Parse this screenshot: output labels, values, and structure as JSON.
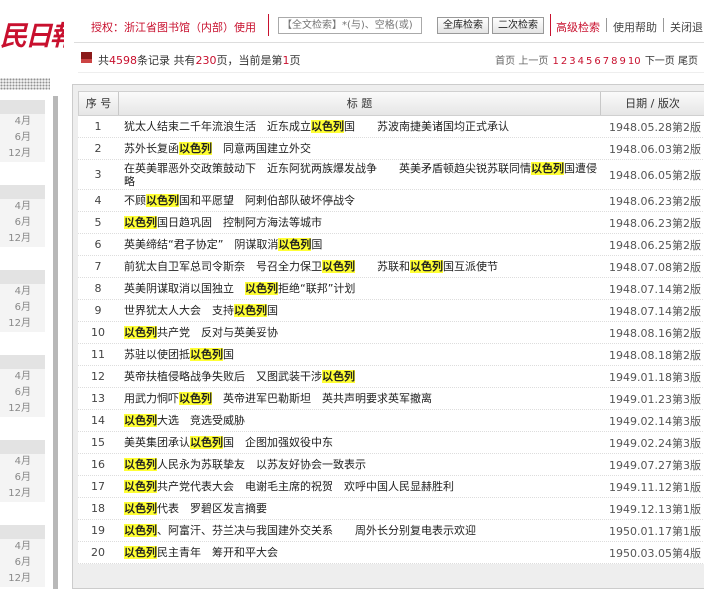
{
  "site": {
    "logo_text": "民日報"
  },
  "sidebar": {
    "groups": [
      {
        "months": [
          "4月",
          "6月",
          "12月"
        ]
      },
      {
        "months": [
          "4月",
          "6月",
          "12月"
        ]
      },
      {
        "months": [
          "4月",
          "6月",
          "12月"
        ]
      },
      {
        "months": [
          "4月",
          "6月",
          "12月"
        ]
      },
      {
        "months": [
          "4月",
          "6月",
          "12月"
        ]
      },
      {
        "months": [
          "4月",
          "6月",
          "12月"
        ]
      }
    ]
  },
  "header": {
    "authorization": "授权：浙江省图书馆（内部）使用",
    "search_placeholder": "【全文检索】*(与)、空格(或)",
    "btn_full": "全库检索",
    "btn_second": "二次检索",
    "link_advanced": "高级检索",
    "link_help": "使用帮助",
    "link_close": "关闭退出"
  },
  "records": {
    "prefix": "共",
    "total": "4598",
    "mid1": "条记录 共有",
    "pages": "230",
    "mid2": "页，当前是第",
    "current": "1",
    "suffix": "页"
  },
  "pager": {
    "first": "首页",
    "prev": "上一页",
    "numbers": [
      "1",
      "2",
      "3",
      "4",
      "5",
      "6",
      "7",
      "8",
      "9",
      "10"
    ],
    "next": "下一页",
    "last": "尾页"
  },
  "table": {
    "headers": {
      "no": "序 号",
      "title": "标 题",
      "date": "日期 / 版次"
    },
    "rows": [
      {
        "no": "1",
        "segments": [
          {
            "t": "犹太人结束二千年流浪生活　近东成立"
          },
          {
            "t": "以色列",
            "hl": true
          },
          {
            "t": "国　　苏波南捷美诸国均正式承认"
          }
        ],
        "date": "1948.05.28第2版"
      },
      {
        "no": "2",
        "segments": [
          {
            "t": "苏外长复函"
          },
          {
            "t": "以色列",
            "hl": true
          },
          {
            "t": "　同意两国建立外交"
          }
        ],
        "date": "1948.06.03第2版"
      },
      {
        "no": "3",
        "segments": [
          {
            "t": "在英美罪恶外交政策鼓动下　近东阿犹两族爆发战争　　英美矛盾顿趋尖锐苏联同情"
          },
          {
            "t": "以色列",
            "hl": true
          },
          {
            "t": "国遭侵略"
          }
        ],
        "date": "1948.06.05第2版"
      },
      {
        "no": "4",
        "segments": [
          {
            "t": "不顾"
          },
          {
            "t": "以色列",
            "hl": true
          },
          {
            "t": "国和平愿望　阿剌伯部队破坏停战令"
          }
        ],
        "date": "1948.06.23第2版"
      },
      {
        "no": "5",
        "segments": [
          {
            "t": "以色列",
            "hl": true
          },
          {
            "t": "国日趋巩固　控制阿方海法等城市"
          }
        ],
        "date": "1948.06.23第2版"
      },
      {
        "no": "6",
        "segments": [
          {
            "t": "英美缔结“君子协定”　阴谋取消"
          },
          {
            "t": "以色列",
            "hl": true
          },
          {
            "t": "国"
          }
        ],
        "date": "1948.06.25第2版"
      },
      {
        "no": "7",
        "segments": [
          {
            "t": "前犹太自卫军总司令斯奈　号召全力保卫"
          },
          {
            "t": "以色列",
            "hl": true
          },
          {
            "t": "　　苏联和"
          },
          {
            "t": "以色列",
            "hl": true
          },
          {
            "t": "国互派使节"
          }
        ],
        "date": "1948.07.08第2版"
      },
      {
        "no": "8",
        "segments": [
          {
            "t": "英美阴谋取消以国独立　"
          },
          {
            "t": "以色列",
            "hl": true
          },
          {
            "t": "拒绝“联邦”计划"
          }
        ],
        "date": "1948.07.14第2版"
      },
      {
        "no": "9",
        "segments": [
          {
            "t": "世界犹太人大会　支持"
          },
          {
            "t": "以色列",
            "hl": true
          },
          {
            "t": "国"
          }
        ],
        "date": "1948.07.14第2版"
      },
      {
        "no": "10",
        "segments": [
          {
            "t": "以色列",
            "hl": true
          },
          {
            "t": "共产党　反对与英美妥协"
          }
        ],
        "date": "1948.08.16第2版"
      },
      {
        "no": "11",
        "segments": [
          {
            "t": "苏驻以使团抵"
          },
          {
            "t": "以色列",
            "hl": true
          },
          {
            "t": "国"
          }
        ],
        "date": "1948.08.18第2版"
      },
      {
        "no": "12",
        "segments": [
          {
            "t": "英帝扶植侵略战争失败后　又图武装干涉"
          },
          {
            "t": "以色列",
            "hl": true
          }
        ],
        "date": "1949.01.18第3版"
      },
      {
        "no": "13",
        "segments": [
          {
            "t": "用武力恫吓"
          },
          {
            "t": "以色列",
            "hl": true
          },
          {
            "t": "　英帝进军巴勒斯坦　英共声明要求英军撤离"
          }
        ],
        "date": "1949.01.23第3版"
      },
      {
        "no": "14",
        "segments": [
          {
            "t": "以色列",
            "hl": true
          },
          {
            "t": "大选　竞选受威胁"
          }
        ],
        "date": "1949.02.14第3版"
      },
      {
        "no": "15",
        "segments": [
          {
            "t": "美英集团承认"
          },
          {
            "t": "以色列",
            "hl": true
          },
          {
            "t": "国　企图加强奴役中东"
          }
        ],
        "date": "1949.02.24第3版"
      },
      {
        "no": "16",
        "segments": [
          {
            "t": "以色列",
            "hl": true
          },
          {
            "t": "人民永为苏联挚友　以苏友好协会一致表示"
          }
        ],
        "date": "1949.07.27第3版"
      },
      {
        "no": "17",
        "segments": [
          {
            "t": "以色列",
            "hl": true
          },
          {
            "t": "共产党代表大会　电谢毛主席的祝贺　欢呼中国人民显赫胜利"
          }
        ],
        "date": "1949.11.12第1版"
      },
      {
        "no": "18",
        "segments": [
          {
            "t": "以色列",
            "hl": true
          },
          {
            "t": "代表　罗碧区发言摘要"
          }
        ],
        "date": "1949.12.13第1版"
      },
      {
        "no": "19",
        "segments": [
          {
            "t": "以色列",
            "hl": true
          },
          {
            "t": "、阿富汗、芬兰决与我国建外交关系　　周外长分别复电表示欢迎"
          }
        ],
        "date": "1950.01.17第1版"
      },
      {
        "no": "20",
        "segments": [
          {
            "t": "以色列",
            "hl": true
          },
          {
            "t": "民主青年　筹开和平大会"
          }
        ],
        "date": "1950.03.05第4版"
      }
    ]
  },
  "colors": {
    "accent": "#c8102e",
    "highlight": "#ffff33"
  }
}
